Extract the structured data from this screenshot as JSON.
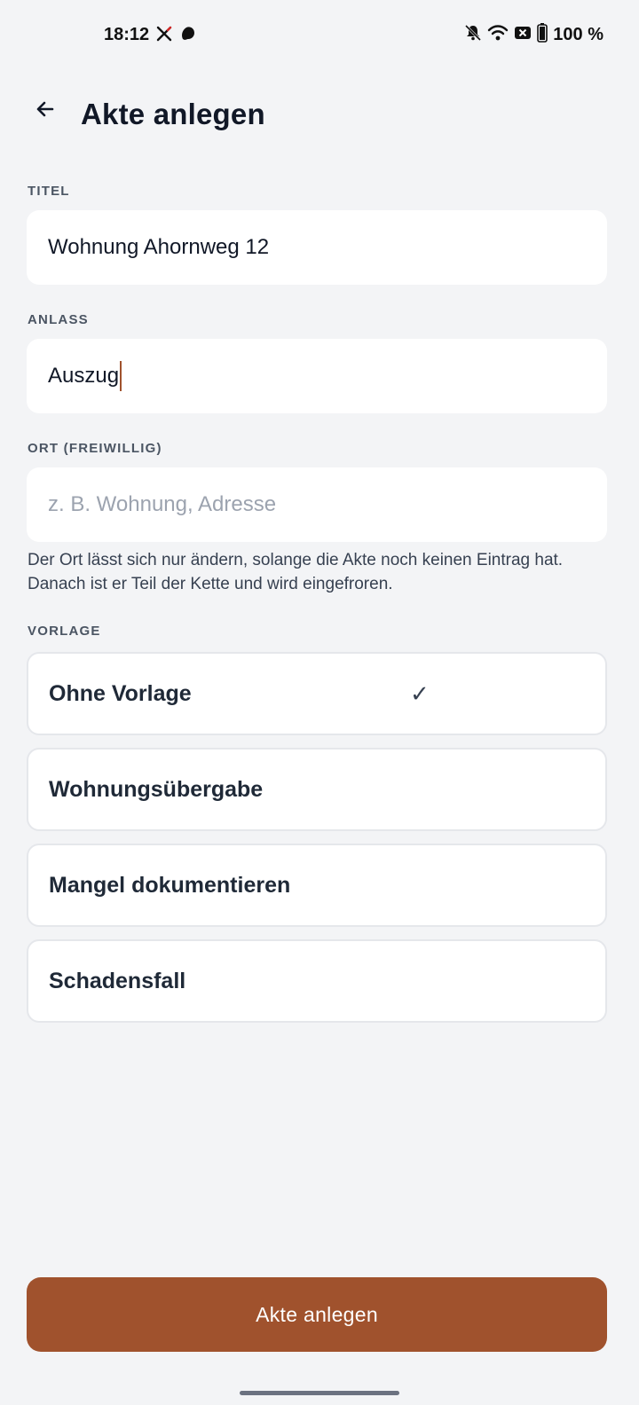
{
  "status_bar": {
    "time": "18:12",
    "left_icons": [
      "x-app-icon",
      "notification-app-icon"
    ],
    "right_icons": [
      "bell-off-icon",
      "wifi-icon",
      "sim-off-icon",
      "battery-icon"
    ],
    "battery": "100 %"
  },
  "header": {
    "back_icon": "arrow-left-icon",
    "title": "Akte anlegen"
  },
  "form": {
    "titel": {
      "label": "TITEL",
      "value": "Wohnung Ahornweg 12"
    },
    "anlass": {
      "label": "ANLASS",
      "value": "Auszug"
    },
    "ort": {
      "label": "ORT (FREIWILLIG)",
      "value": "",
      "placeholder": "z. B. Wohnung, Adresse",
      "hint": "Der Ort lässt sich nur ändern, solange die Akte noch keinen Eintrag hat. Danach ist er Teil der Kette und wird eingefroren."
    },
    "vorlage": {
      "label": "VORLAGE",
      "options": [
        {
          "label": "Ohne Vorlage",
          "selected": true
        },
        {
          "label": "Wohnungsübergabe",
          "selected": false
        },
        {
          "label": "Mangel dokumentieren",
          "selected": false
        },
        {
          "label": "Schadensfall",
          "selected": false
        }
      ],
      "check_mark": "✓"
    }
  },
  "submit": {
    "label": "Akte anlegen"
  },
  "colors": {
    "accent": "#a0522d",
    "background": "#f3f4f6",
    "card": "#ffffff"
  }
}
